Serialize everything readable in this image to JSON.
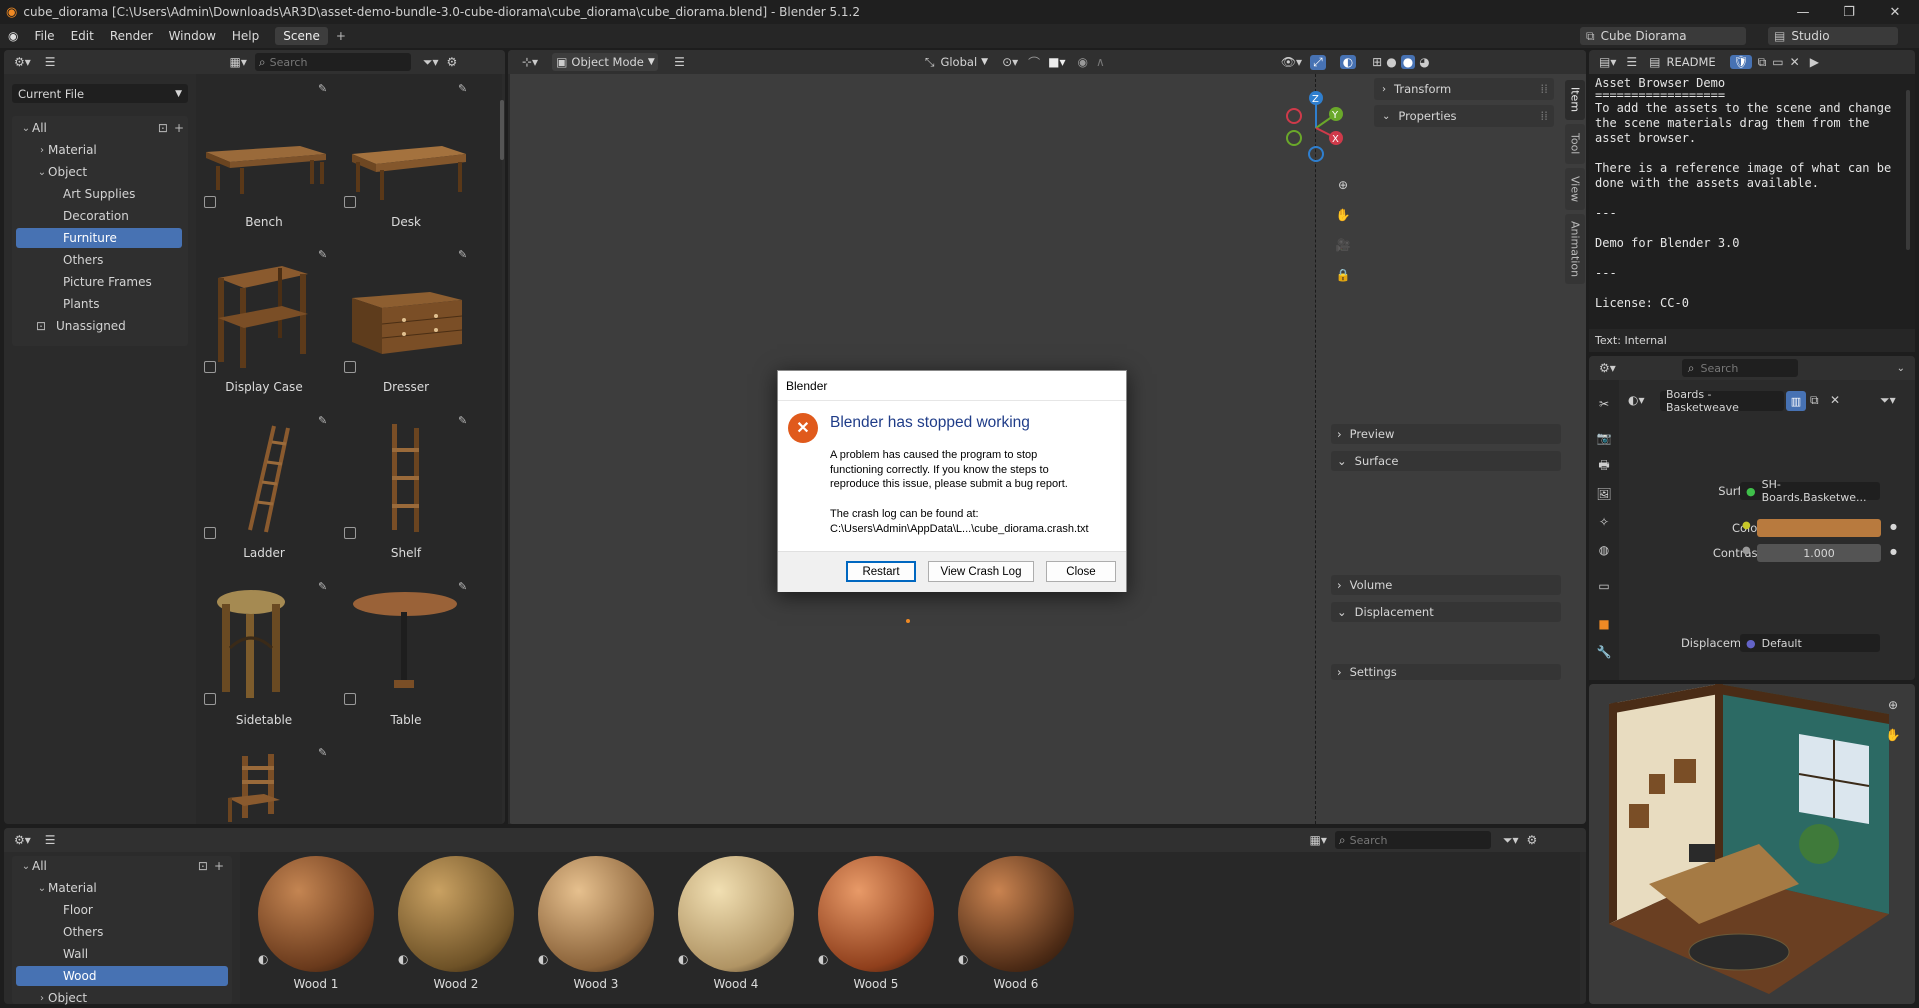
{
  "window": {
    "title": "cube_diorama [C:\\Users\\Admin\\Downloads\\AR3D\\asset-demo-bundle-3.0-cube-diorama\\cube_diorama\\cube_diorama.blend] - Blender 5.1.2"
  },
  "menu": {
    "items": [
      "File",
      "Edit",
      "Render",
      "Window",
      "Help"
    ],
    "workspace_tab": "Scene",
    "scene_name": "Cube Diorama",
    "view_layer": "Studio"
  },
  "asset_browser_top": {
    "search_placeholder": "Search",
    "library": "Current File",
    "tree": [
      {
        "label": "All"
      },
      {
        "label": "Material"
      },
      {
        "label": "Object"
      },
      {
        "label": "Art Supplies"
      },
      {
        "label": "Decoration"
      },
      {
        "label": "Furniture"
      },
      {
        "label": "Others"
      },
      {
        "label": "Picture Frames"
      },
      {
        "label": "Plants"
      },
      {
        "label": "Unassigned"
      }
    ],
    "assets": [
      "Bench",
      "Desk",
      "Display Case",
      "Dresser",
      "Ladder",
      "Shelf",
      "Sidetable",
      "Table"
    ]
  },
  "viewport": {
    "mode": "Object Mode",
    "transform_orientation": "Global",
    "n_panel": {
      "transform": "Transform",
      "properties": "Properties"
    },
    "side_tabs": [
      "Item",
      "Tool",
      "View",
      "Animation"
    ],
    "gizmo": {
      "z": "Z",
      "y": "Y",
      "x": "X"
    }
  },
  "text_editor": {
    "text_name": "README",
    "lines": [
      "Asset Browser Demo",
      "==================",
      "To add the assets to the scene and change",
      "the scene materials drag them from the",
      "asset browser.",
      "",
      "There is a reference image of what can be",
      "done with the assets available.",
      "",
      "---",
      "",
      "Demo for Blender 3.0",
      "",
      "---",
      "",
      "License: CC-0"
    ],
    "footer": "Text: Internal"
  },
  "properties": {
    "search_placeholder": "Search",
    "material_name": "Boards - Basketweave",
    "sections": {
      "preview": "Preview",
      "surface": "Surface",
      "volume": "Volume",
      "displacement": "Displacement",
      "settings": "Settings"
    },
    "surface_label": "Surface",
    "surface_value": "SH-Boards.Basketwe...",
    "color_label": "Color",
    "color_value": "#b87a3e",
    "contrast_label": "Contrast",
    "contrast_value": "1.000",
    "displacement_label": "Displacement",
    "displacement_value": "Default"
  },
  "asset_browser_bottom": {
    "search_placeholder": "Search",
    "tree": [
      {
        "label": "All"
      },
      {
        "label": "Material"
      },
      {
        "label": "Floor"
      },
      {
        "label": "Others"
      },
      {
        "label": "Wall"
      },
      {
        "label": "Wood"
      },
      {
        "label": "Object"
      }
    ],
    "materials": [
      {
        "name": "Wood 1",
        "c1": "#c48552",
        "c2": "#6a3a1c"
      },
      {
        "name": "Wood 2",
        "c1": "#c9a162",
        "c2": "#6e5227"
      },
      {
        "name": "Wood 3",
        "c1": "#e6c08e",
        "c2": "#8a6239"
      },
      {
        "name": "Wood 4",
        "c1": "#f1dfb2",
        "c2": "#b09464"
      },
      {
        "name": "Wood 5",
        "c1": "#e89a68",
        "c2": "#8f3f1c"
      },
      {
        "name": "Wood 6",
        "c1": "#c98350",
        "c2": "#4f2c16"
      }
    ]
  },
  "dialog": {
    "title": "Blender",
    "heading": "Blender has stopped working",
    "body": [
      "A problem has caused the program to stop",
      "functioning correctly. If you know the steps to",
      "reproduce this issue, please submit a bug report."
    ],
    "log_intro": "The crash log can be found at:",
    "log_path": "C:\\Users\\Admin\\AppData\\L...\\cube_diorama.crash.txt",
    "buttons": {
      "restart": "Restart",
      "view_log": "View Crash Log",
      "close": "Close"
    },
    "error_color": "#e05a1c"
  }
}
